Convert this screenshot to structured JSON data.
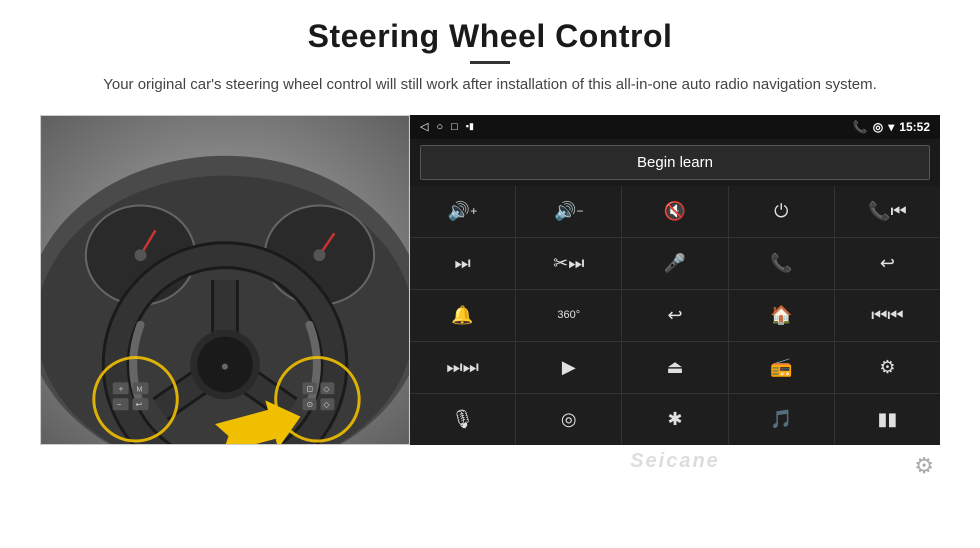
{
  "header": {
    "title": "Steering Wheel Control",
    "subtitle": "Your original car's steering wheel control will still work after installation of this all-in-one auto radio navigation system."
  },
  "android_ui": {
    "status_bar": {
      "back_icon": "◁",
      "home_icon": "○",
      "recents_icon": "□",
      "sd_icon": "▪▮",
      "phone_icon": "📞",
      "location_icon": "⊙",
      "wifi_icon": "▾",
      "time": "15:52"
    },
    "begin_learn_label": "Begin learn",
    "controls": [
      {
        "icon": "🔊+",
        "label": "vol-up"
      },
      {
        "icon": "🔊−",
        "label": "vol-down"
      },
      {
        "icon": "🔇",
        "label": "mute"
      },
      {
        "icon": "⏻",
        "label": "power"
      },
      {
        "icon": "⏮",
        "label": "prev-call"
      },
      {
        "icon": "⏭",
        "label": "next"
      },
      {
        "icon": "✂⏭",
        "label": "ffwd"
      },
      {
        "icon": "🎤",
        "label": "mic"
      },
      {
        "icon": "📞",
        "label": "call"
      },
      {
        "icon": "↩",
        "label": "hang-up"
      },
      {
        "icon": "🔔",
        "label": "horn"
      },
      {
        "icon": "360°",
        "label": "camera"
      },
      {
        "icon": "↩",
        "label": "back"
      },
      {
        "icon": "🏠",
        "label": "home"
      },
      {
        "icon": "⏮⏮",
        "label": "prev"
      },
      {
        "icon": "⏭⏭",
        "label": "next2"
      },
      {
        "icon": "▶",
        "label": "nav"
      },
      {
        "icon": "⏏",
        "label": "eject"
      },
      {
        "icon": "📻",
        "label": "radio"
      },
      {
        "icon": "⚙",
        "label": "settings"
      },
      {
        "icon": "🎙",
        "label": "voice"
      },
      {
        "icon": "⊙",
        "label": "circle"
      },
      {
        "icon": "✱",
        "label": "bluetooth"
      },
      {
        "icon": "🎵",
        "label": "music"
      },
      {
        "icon": "▮▮",
        "label": "equalizer"
      }
    ],
    "watermark": "Seicane",
    "gear_icon": "⚙"
  }
}
